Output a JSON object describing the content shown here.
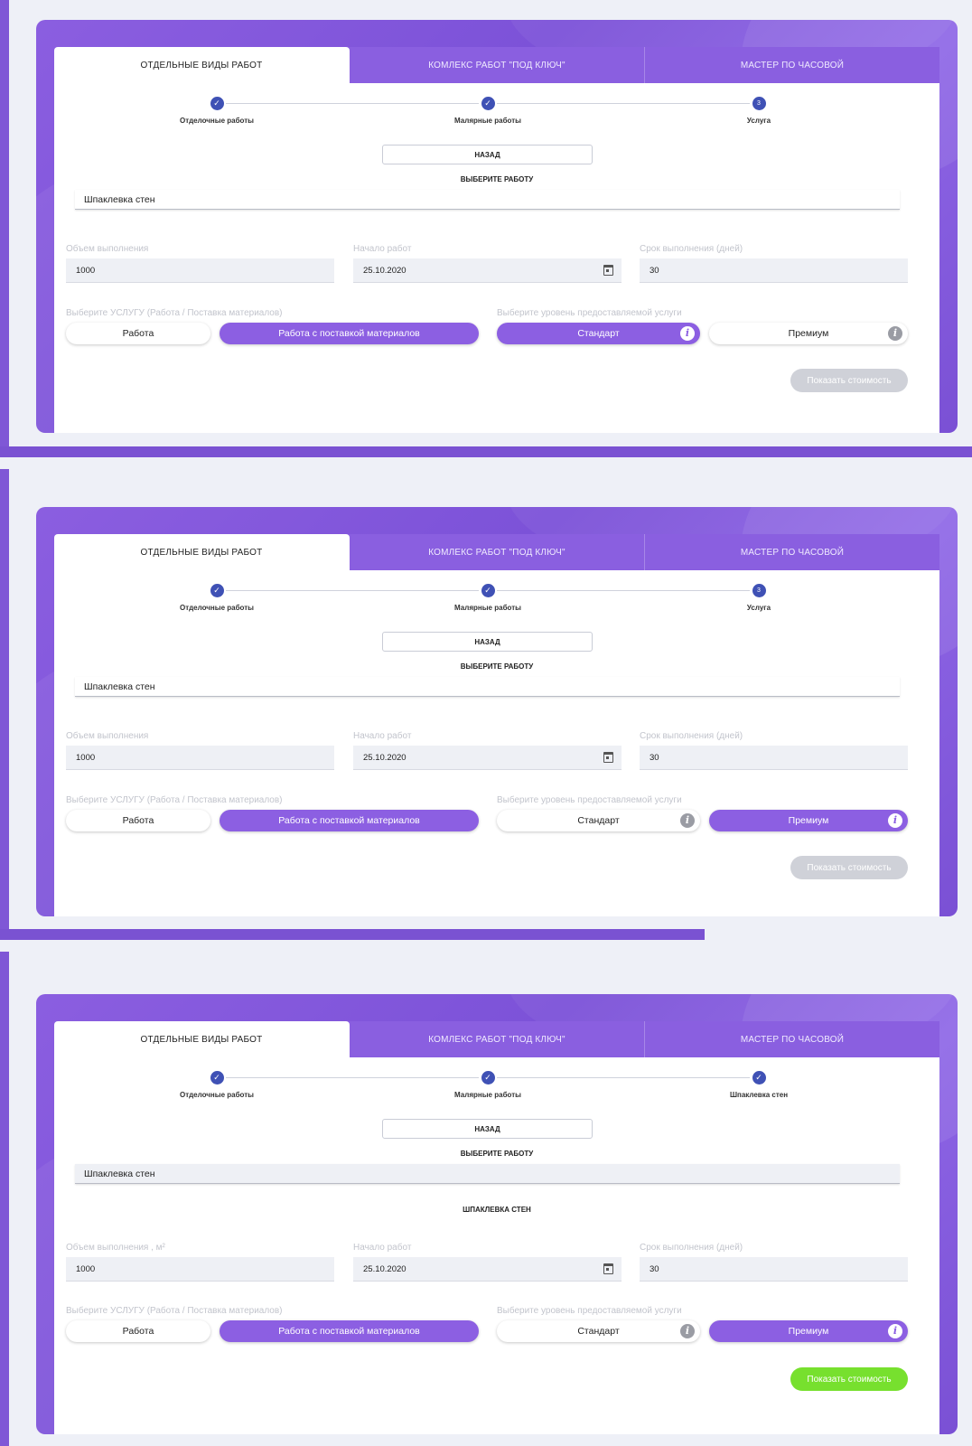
{
  "tabs": [
    "ОТДЕЛЬНЫЕ ВИДЫ РАБОТ",
    "КОМЛЕКС РАБОТ \"ПОД КЛЮЧ\"",
    "МАСТЕР ПО ЧАСОВОЙ"
  ],
  "colors": {
    "accent": "#8c5fe2",
    "step": "#3f51b5",
    "success": "#77e02e",
    "disabled": "#cfd1d8"
  },
  "icons": {
    "check": "check-icon",
    "calendar": "calendar-icon",
    "info": "info-icon"
  },
  "panels": [
    {
      "steps": [
        {
          "label": "Отделочные работы",
          "state": "done"
        },
        {
          "label": "Малярные работы",
          "state": "done"
        },
        {
          "label": "Услуга",
          "state": "current",
          "num": "3"
        }
      ],
      "back_label": "НАЗАД",
      "choose_label": "ВЫБЕРИТЕ РАБОТУ",
      "selected_work": "Шпаклевка стен",
      "work_title": "",
      "volume_label": "Объем выполнения",
      "volume_value": "1000",
      "start_label": "Начало работ",
      "start_value": "25.10.2020",
      "term_label": "Срок выполнения (дней)",
      "term_value": "30",
      "service_label": "Выберите УСЛУГУ (Работа / Поставка материалов)",
      "service_options": [
        "Работа",
        "Работа с поставкой материалов"
      ],
      "service_selected": 1,
      "level_label": "Выберите уровень предоставляемой услуги",
      "level_options": [
        "Стандарт",
        "Премиум"
      ],
      "level_selected": 0,
      "show_cost_label": "Показать стоимость",
      "show_cost_enabled": false
    },
    {
      "steps": [
        {
          "label": "Отделочные работы",
          "state": "done"
        },
        {
          "label": "Малярные работы",
          "state": "done"
        },
        {
          "label": "Услуга",
          "state": "current",
          "num": "3"
        }
      ],
      "back_label": "НАЗАД",
      "choose_label": "ВЫБЕРИТЕ РАБОТУ",
      "selected_work": "Шпаклевка стен",
      "work_title": "",
      "volume_label": "Объем выполнения",
      "volume_value": "1000",
      "start_label": "Начало работ",
      "start_value": "25.10.2020",
      "term_label": "Срок выполнения (дней)",
      "term_value": "30",
      "service_label": "Выберите УСЛУГУ (Работа / Поставка материалов)",
      "service_options": [
        "Работа",
        "Работа с поставкой материалов"
      ],
      "service_selected": 1,
      "level_label": "Выберите уровень предоставляемой услуги",
      "level_options": [
        "Стандарт",
        "Премиум"
      ],
      "level_selected": 1,
      "show_cost_label": "Показать стоимость",
      "show_cost_enabled": false
    },
    {
      "steps": [
        {
          "label": "Отделочные работы",
          "state": "done"
        },
        {
          "label": "Малярные работы",
          "state": "done"
        },
        {
          "label": "Шпаклевка стен",
          "state": "done"
        }
      ],
      "back_label": "НАЗАД",
      "choose_label": "ВЫБЕРИТЕ РАБОТУ",
      "selected_work": "Шпаклевка стен",
      "work_title": "ШПАКЛЕВКА СТЕН",
      "volume_label": "Объем выполнения , м²",
      "volume_value": "1000",
      "start_label": "Начало работ",
      "start_value": "25.10.2020",
      "term_label": "Срок выполнения (дней)",
      "term_value": "30",
      "service_label": "Выберите УСЛУГУ (Работа / Поставка материалов)",
      "service_options": [
        "Работа",
        "Работа с поставкой материалов"
      ],
      "service_selected": 1,
      "level_label": "Выберите уровень предоставляемой услуги",
      "level_options": [
        "Стандарт",
        "Премиум"
      ],
      "level_selected": 1,
      "show_cost_label": "Показать стоимость",
      "show_cost_enabled": true
    }
  ]
}
